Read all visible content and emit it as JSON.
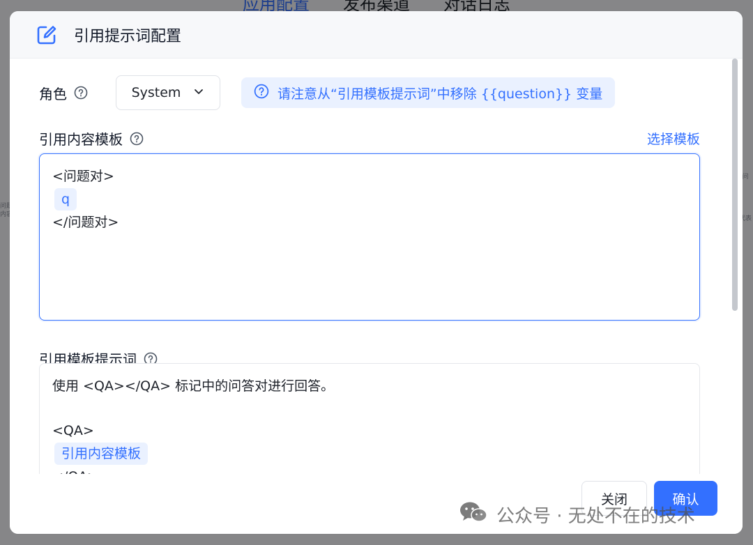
{
  "background": {
    "tabs": [
      "应用配置",
      "发布渠道",
      "对话日志"
    ],
    "side_left_text": [
      "问题",
      "内容"
    ],
    "side_right_text": [
      "“问",
      "代表"
    ]
  },
  "dialog": {
    "title": "引用提示词配置",
    "role_label": "角色",
    "role_value": "System",
    "tip": "请注意从“引用模板提示词”中移除 {{question}} 变量",
    "quote_template_label": "引用内容模板",
    "choose_template_link": "选择模板",
    "quote_template": {
      "line1": "<问题对>",
      "var": "q",
      "line3": "</问题对>"
    },
    "quote_prompt_label": "引用模板提示词",
    "quote_prompt": {
      "line1": "使用 <QA></QA> 标记中的问答对进行回答。",
      "line3": "<QA>",
      "var": "引用内容模板",
      "line5": "</QA>"
    },
    "close_button": "关闭",
    "confirm_button": "确认"
  },
  "watermark": "公众号 · 无处不在的技术",
  "colors": {
    "primary": "#3370ff",
    "tip_bg": "#eaf1ff",
    "header_bg": "#f7f8fa"
  }
}
